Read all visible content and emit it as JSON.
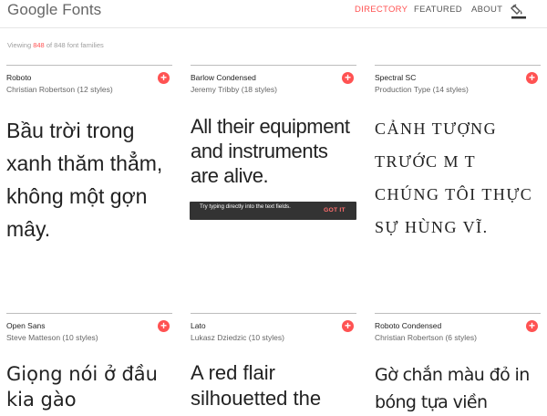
{
  "header": {
    "logo": "Google Fonts",
    "nav": [
      "DIRECTORY",
      "FEATURED",
      "ABOUT"
    ],
    "active_nav": "DIRECTORY"
  },
  "status": {
    "prefix": "Viewing ",
    "shown": "848",
    "suffix": " of 848 font families"
  },
  "cards": [
    {
      "name": "Roboto",
      "meta": "Christian Robertson (12 styles)",
      "sample": "Bầu trời trong xanh thăm thẳm, không một gợn mây."
    },
    {
      "name": "Barlow Condensed",
      "meta": "Jeremy Tribby (18 styles)",
      "sample": "All their equipment and instruments are alive."
    },
    {
      "name": "Spectral SC",
      "meta": "Production Type (14 styles)",
      "sample": "CẢNH TƯỢNG TRƯỚC M  T CHÚNG TÔI THỰC SỰ HÙNG VĨ."
    },
    {
      "name": "Open Sans",
      "meta": "Steve Matteson (10 styles)",
      "sample": "Giọng nói ở đầu kia gào"
    },
    {
      "name": "Lato",
      "meta": "Lukasz Dziedzic (10 styles)",
      "sample": "A red flair silhouetted the"
    },
    {
      "name": "Roboto Condensed",
      "meta": "Christian Robertson (6 styles)",
      "sample": "Gờ chắn màu đỏ in bóng tựa viền"
    }
  ],
  "add_glyph": "+",
  "tooltip": {
    "message": "Try typing directly into the text fields.",
    "action": "GOT IT"
  },
  "colors": {
    "accent": "#ff5252",
    "tooltip_bg": "#333333",
    "rule": "#bdbdbd"
  },
  "icons": [
    "paint-bucket-icon",
    "add-icon"
  ]
}
